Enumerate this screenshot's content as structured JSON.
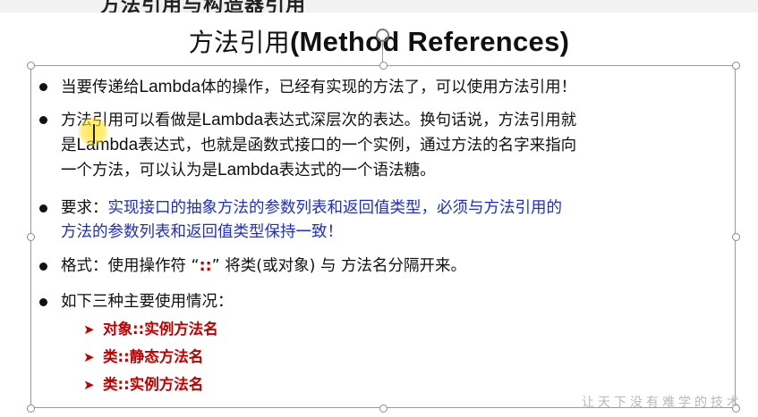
{
  "header": {
    "top_text": "方法引用与构造器引用"
  },
  "slide": {
    "title_cn": "方法引用",
    "title_en": "(Method References)"
  },
  "bullets": {
    "b1": {
      "t1": "当要传递给",
      "t2": "Lambda",
      "t3": "体的操作，已经有实现的方法了，可以使用方法引用！"
    },
    "b2": {
      "t1": "方法引用可以看做是",
      "t2": "Lambda",
      "t3": "表达式深层次的表达。换句话说，方法引用就",
      "t4": "是",
      "t5": "Lambda",
      "t6": "表达式，也就是函数式接口的一个实例，通过方法的名字来指向",
      "t7": "一个方法，可以认为是",
      "t8": "Lambda",
      "t9": "表达式的一个语法糖。"
    },
    "b3": {
      "t1": "要求：",
      "t2": "实现接口的抽象方法的参数列表和返回值类型，必须与方法引用的",
      "t3": "方法的参数列表和返回值类型保持一致！"
    },
    "b4": {
      "t1": "格式：使用操作符 “",
      "t2": "::",
      "t3": "” 将类(或对象) 与 方法名分隔开来。"
    },
    "b5": {
      "t1": "如下三种主要使用情况："
    }
  },
  "cases": [
    "对象::实例方法名",
    "类::静态方法名",
    "类::实例方法名"
  ],
  "watermark": "让天下没有难学的技术"
}
